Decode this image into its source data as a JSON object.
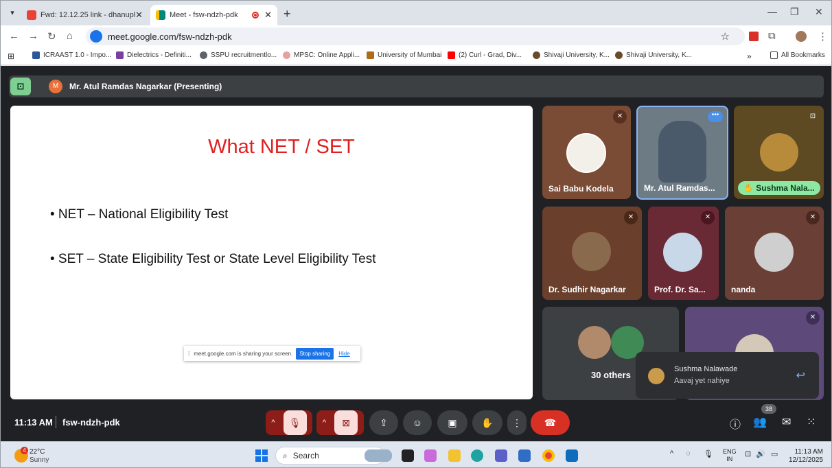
{
  "browser": {
    "tabs": [
      {
        "title": "Fwd: 12.12.25 link - dhanuphys",
        "active": false
      },
      {
        "title": "Meet - fsw-ndzh-pdk",
        "active": true
      }
    ],
    "url": "meet.google.com/fsw-ndzh-pdk",
    "bookmarks": [
      "ICRAAST 1.0 - Impo...",
      "Dielectrics - Definiti...",
      "SSPU recruitmentlo...",
      "MPSC: Online Appli...",
      "University of Mumbai",
      "(2) Curl - Grad, Div...",
      "Shivaji University, K...",
      "Shivaji University, K..."
    ],
    "bookmarks_overflow": "»",
    "all_bookmarks": "All Bookmarks"
  },
  "meet": {
    "presenter_initial": "M",
    "presenter_label": "Mr. Atul Ramdas Nagarkar (Presenting)",
    "slide": {
      "title": "What NET / SET",
      "bullets": [
        "• NET – National Eligibility Test",
        "• SET – State Eligibility Test or State Level Eligibility Test"
      ]
    },
    "share_notice": {
      "text": "meet.google.com is sharing your screen.",
      "stop": "Stop sharing",
      "hide": "Hide"
    },
    "participants": [
      {
        "name": "Sai Babu Kodela",
        "muted": true
      },
      {
        "name": "Mr. Atul Ramdas...",
        "muted": false
      },
      {
        "name": "Sushma Nala...",
        "hand_raised": true
      },
      {
        "name": "Dr. Sudhir Nagarkar",
        "muted": true
      },
      {
        "name": "Prof. Dr. Sa...",
        "muted": true
      },
      {
        "name": "nanda",
        "muted": true
      }
    ],
    "others_label": "30 others",
    "toast": {
      "name": "Sushma Nalawade",
      "message": "Aavaj yet nahiye"
    },
    "clock": "11:13 AM",
    "meeting_code": "fsw-ndzh-pdk",
    "people_count": "38"
  },
  "taskbar": {
    "temp": "22°C",
    "weather": "Sunny",
    "weather_badge": "4",
    "search": "Search",
    "lang_top": "ENG",
    "lang_bottom": "IN",
    "time": "11:13 AM",
    "date": "12/12/2025"
  }
}
